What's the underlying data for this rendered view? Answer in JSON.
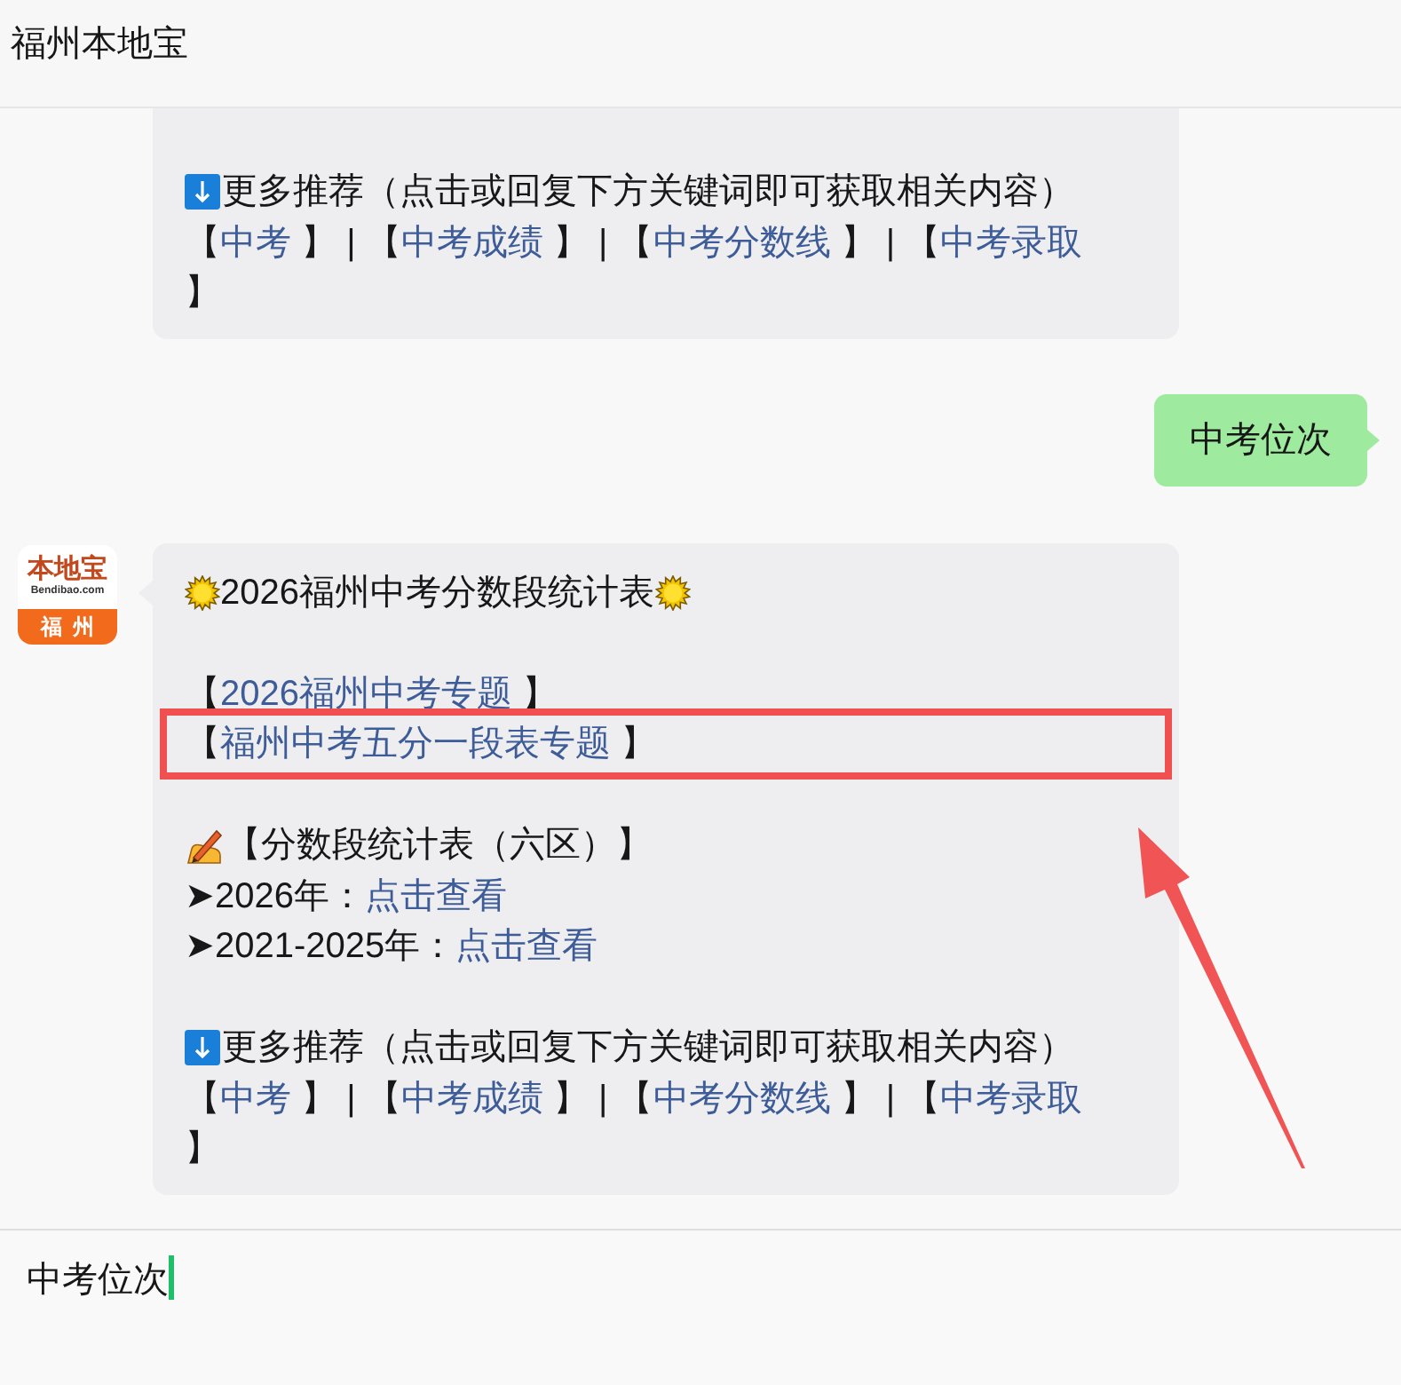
{
  "header": {
    "title": "福州本地宝"
  },
  "messages": [
    {
      "kind": "bot_cut",
      "sections": [
        {
          "lines": [
            {
              "kind": "down",
              "highlighted": false,
              "segments": [
                {
                  "kind": "text",
                  "text": "更多推荐（点击或回复下方关键词即可获取相关内容）"
                }
              ]
            },
            {
              "kind": "plain",
              "highlighted": false,
              "segments": [
                {
                  "kind": "text",
                  "text": "【"
                },
                {
                  "kind": "link",
                  "text": "中考"
                },
                {
                  "kind": "text",
                  "text": " 】 | 【"
                },
                {
                  "kind": "link",
                  "text": "中考成绩"
                },
                {
                  "kind": "text",
                  "text": " 】 | 【"
                },
                {
                  "kind": "link",
                  "text": "中考分数线"
                },
                {
                  "kind": "text",
                  "text": " 】 | 【"
                },
                {
                  "kind": "link",
                  "text": "中考录取"
                }
              ]
            },
            {
              "kind": "plain",
              "highlighted": false,
              "segments": [
                {
                  "kind": "text",
                  "text": "】"
                }
              ]
            }
          ]
        }
      ]
    },
    {
      "kind": "user",
      "text": "中考位次"
    },
    {
      "kind": "bot",
      "avatar": {
        "brand": "本地宝",
        "domain": "Bendibao.com",
        "city": "福州"
      },
      "sections": [
        {
          "lines": [
            {
              "kind": "sun",
              "highlighted": false,
              "segments": [
                {
                  "kind": "text",
                  "text": "2026福州中考分数段统计表"
                }
              ]
            }
          ]
        },
        {
          "lines": [
            {
              "kind": "plain",
              "highlighted": false,
              "segments": [
                {
                  "kind": "text",
                  "text": "【"
                },
                {
                  "kind": "link",
                  "text": "2026福州中考专题"
                },
                {
                  "kind": "text",
                  "text": " 】"
                }
              ]
            },
            {
              "kind": "plain",
              "highlighted": true,
              "segments": [
                {
                  "kind": "text",
                  "text": "【"
                },
                {
                  "kind": "link",
                  "text": "福州中考五分一段表专题"
                },
                {
                  "kind": "text",
                  "text": " 】"
                }
              ]
            }
          ]
        },
        {
          "lines": [
            {
              "kind": "pencil",
              "highlighted": false,
              "segments": [
                {
                  "kind": "text",
                  "text": "【分数段统计表（六区）】"
                }
              ]
            },
            {
              "kind": "plain",
              "highlighted": false,
              "segments": [
                {
                  "kind": "text",
                  "text": "➤2026年："
                },
                {
                  "kind": "link",
                  "text": "点击查看"
                }
              ]
            },
            {
              "kind": "plain",
              "highlighted": false,
              "segments": [
                {
                  "kind": "text",
                  "text": "➤2021-2025年："
                },
                {
                  "kind": "link",
                  "text": "点击查看"
                }
              ]
            }
          ]
        },
        {
          "lines": [
            {
              "kind": "down",
              "highlighted": false,
              "segments": [
                {
                  "kind": "text",
                  "text": "更多推荐（点击或回复下方关键词即可获取相关内容）"
                }
              ]
            },
            {
              "kind": "plain",
              "highlighted": false,
              "segments": [
                {
                  "kind": "text",
                  "text": "【"
                },
                {
                  "kind": "link",
                  "text": "中考"
                },
                {
                  "kind": "text",
                  "text": " 】 | 【"
                },
                {
                  "kind": "link",
                  "text": "中考成绩"
                },
                {
                  "kind": "text",
                  "text": " 】 | 【"
                },
                {
                  "kind": "link",
                  "text": "中考分数线"
                },
                {
                  "kind": "text",
                  "text": " 】 | 【"
                },
                {
                  "kind": "link",
                  "text": "中考录取"
                }
              ]
            },
            {
              "kind": "plain",
              "highlighted": false,
              "segments": [
                {
                  "kind": "text",
                  "text": "】"
                }
              ]
            }
          ]
        }
      ]
    }
  ],
  "input": {
    "value": "中考位次"
  }
}
